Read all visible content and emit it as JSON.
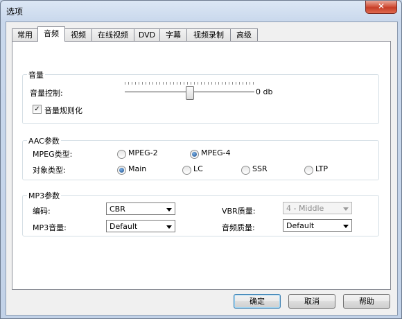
{
  "window": {
    "title": "选项",
    "close": "✕"
  },
  "tabs": [
    "常用",
    "音频",
    "视频",
    "在线视频",
    "DVD",
    "字幕",
    "视频录制",
    "高级"
  ],
  "volume": {
    "group_title": "音量",
    "control_label": "音量控制:",
    "value_text": "0 db",
    "slider_level": 0.5,
    "normalize_label": "音量规则化",
    "normalize_checked": true
  },
  "aac": {
    "group_title": "AAC参数",
    "mpeg_type_label": "MPEG类型:",
    "mpeg_options": [
      "MPEG-2",
      "MPEG-4"
    ],
    "mpeg_selected": "MPEG-4",
    "object_type_label": "对象类型:",
    "object_options": [
      "Main",
      "LC",
      "SSR",
      "LTP"
    ],
    "object_selected": "Main"
  },
  "mp3": {
    "group_title": "MP3参数",
    "encode_label": "编码:",
    "encode_value": "CBR",
    "volume_label": "MP3音量:",
    "volume_value": "Default",
    "vbr_label": "VBR质量:",
    "vbr_value": "4 - Middle",
    "audio_quality_label": "音频质量:",
    "audio_quality_value": "Default"
  },
  "buttons": {
    "ok": "确定",
    "cancel": "取消",
    "help": "帮助"
  }
}
